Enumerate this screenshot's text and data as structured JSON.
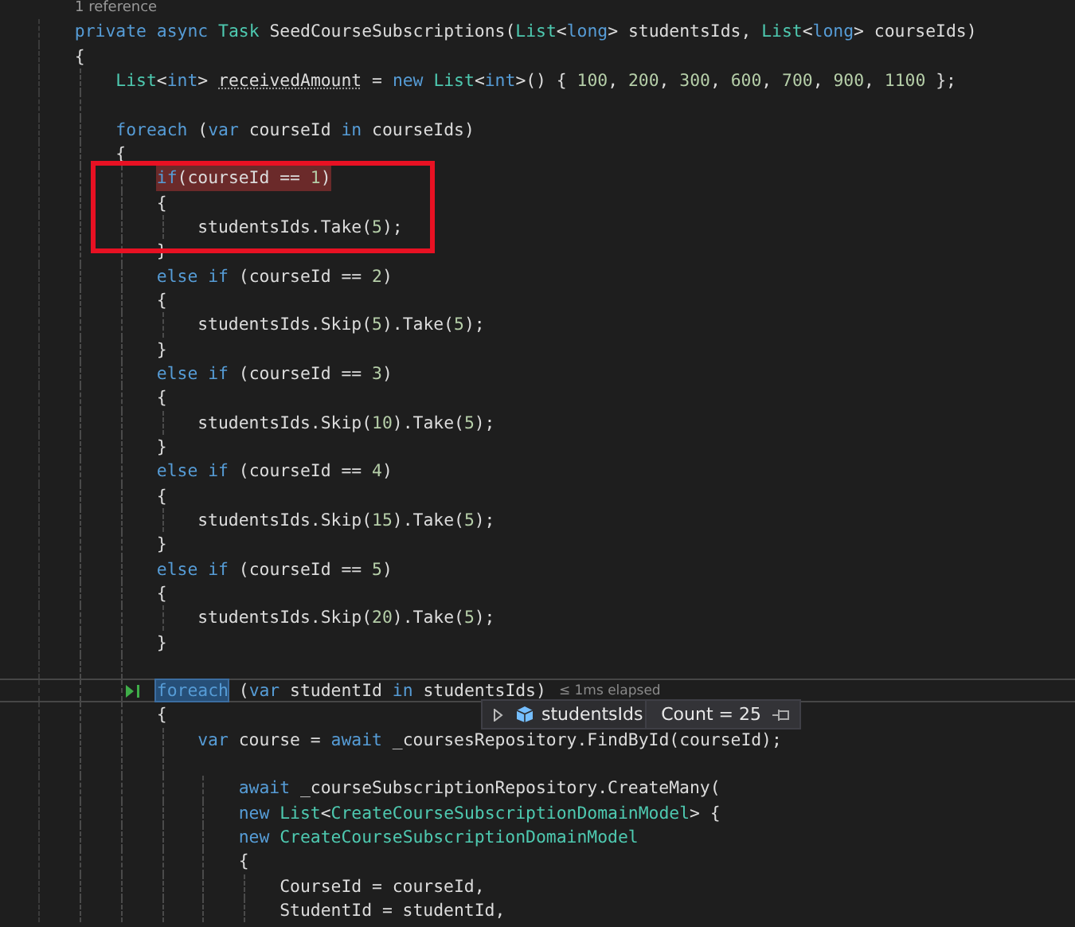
{
  "codelens": "1 reference",
  "lines": [
    {
      "kind": "code",
      "tokens": [
        {
          "kind": "kw",
          "text": "private "
        },
        {
          "kind": "kw",
          "text": "async "
        },
        {
          "kind": "ty",
          "text": "Task"
        },
        {
          "kind": "txt",
          "text": " SeedCourseSubscriptions("
        },
        {
          "kind": "ty",
          "text": "List"
        },
        {
          "kind": "txt",
          "text": "<"
        },
        {
          "kind": "kw",
          "text": "long"
        },
        {
          "kind": "txt",
          "text": "> studentsIds, "
        },
        {
          "kind": "ty",
          "text": "List"
        },
        {
          "kind": "txt",
          "text": "<"
        },
        {
          "kind": "kw",
          "text": "long"
        },
        {
          "kind": "txt",
          "text": "> courseIds)"
        }
      ]
    },
    {
      "kind": "code",
      "tokens": [
        {
          "kind": "txt",
          "text": "{"
        }
      ],
      "children": [
        {
          "kind": "code",
          "tokens": [
            {
              "kind": "ty",
              "text": "List"
            },
            {
              "kind": "txt",
              "text": "<"
            },
            {
              "kind": "kw",
              "text": "int"
            },
            {
              "kind": "txt",
              "text": "> "
            },
            {
              "kind": "hint",
              "text": "receivedAmount"
            },
            {
              "kind": "txt",
              "text": " = "
            },
            {
              "kind": "kw",
              "text": "new "
            },
            {
              "kind": "ty",
              "text": "List"
            },
            {
              "kind": "txt",
              "text": "<"
            },
            {
              "kind": "kw",
              "text": "int"
            },
            {
              "kind": "txt",
              "text": ">() { "
            },
            {
              "kind": "num",
              "text": "100"
            },
            {
              "kind": "txt",
              "text": ", "
            },
            {
              "kind": "num",
              "text": "200"
            },
            {
              "kind": "txt",
              "text": ", "
            },
            {
              "kind": "num",
              "text": "300"
            },
            {
              "kind": "txt",
              "text": ", "
            },
            {
              "kind": "num",
              "text": "600"
            },
            {
              "kind": "txt",
              "text": ", "
            },
            {
              "kind": "num",
              "text": "700"
            },
            {
              "kind": "txt",
              "text": ", "
            },
            {
              "kind": "num",
              "text": "900"
            },
            {
              "kind": "txt",
              "text": ", "
            },
            {
              "kind": "num",
              "text": "1100"
            },
            {
              "kind": "txt",
              "text": " };"
            }
          ]
        },
        {
          "kind": "blank"
        },
        {
          "kind": "code",
          "tokens": [
            {
              "kind": "kw",
              "text": "foreach"
            },
            {
              "kind": "txt",
              "text": " ("
            },
            {
              "kind": "kw",
              "text": "var"
            },
            {
              "kind": "txt",
              "text": " courseId "
            },
            {
              "kind": "kw",
              "text": "in"
            },
            {
              "kind": "txt",
              "text": " courseIds)"
            }
          ]
        },
        {
          "kind": "code",
          "tokens": [
            {
              "kind": "txt",
              "text": "{"
            }
          ],
          "children": [
            {
              "kind": "hit",
              "tokens": [
                {
                  "kind": "kw",
                  "text": "if"
                },
                {
                  "kind": "txt",
                  "text": "(courseId == "
                },
                {
                  "kind": "num",
                  "text": "1"
                },
                {
                  "kind": "txt",
                  "text": ")"
                }
              ]
            },
            {
              "kind": "code",
              "tokens": [
                {
                  "kind": "txt",
                  "text": "{"
                }
              ],
              "children": [
                {
                  "kind": "code",
                  "tokens": [
                    {
                      "kind": "txt",
                      "text": "studentsIds.Take("
                    },
                    {
                      "kind": "num",
                      "text": "5"
                    },
                    {
                      "kind": "txt",
                      "text": ");"
                    }
                  ]
                }
              ]
            },
            {
              "kind": "code",
              "tokens": [
                {
                  "kind": "txt",
                  "text": "}"
                }
              ]
            },
            {
              "kind": "code",
              "tokens": [
                {
                  "kind": "kw",
                  "text": "else "
                },
                {
                  "kind": "kw",
                  "text": "if"
                },
                {
                  "kind": "txt",
                  "text": " (courseId == "
                },
                {
                  "kind": "num",
                  "text": "2"
                },
                {
                  "kind": "txt",
                  "text": ")"
                }
              ]
            },
            {
              "kind": "code",
              "tokens": [
                {
                  "kind": "txt",
                  "text": "{"
                }
              ],
              "children": [
                {
                  "kind": "code",
                  "tokens": [
                    {
                      "kind": "txt",
                      "text": "studentsIds.Skip("
                    },
                    {
                      "kind": "num",
                      "text": "5"
                    },
                    {
                      "kind": "txt",
                      "text": ").Take("
                    },
                    {
                      "kind": "num",
                      "text": "5"
                    },
                    {
                      "kind": "txt",
                      "text": ");"
                    }
                  ]
                }
              ]
            },
            {
              "kind": "code",
              "tokens": [
                {
                  "kind": "txt",
                  "text": "}"
                }
              ]
            },
            {
              "kind": "code",
              "tokens": [
                {
                  "kind": "kw",
                  "text": "else "
                },
                {
                  "kind": "kw",
                  "text": "if"
                },
                {
                  "kind": "txt",
                  "text": " (courseId == "
                },
                {
                  "kind": "num",
                  "text": "3"
                },
                {
                  "kind": "txt",
                  "text": ")"
                }
              ]
            },
            {
              "kind": "code",
              "tokens": [
                {
                  "kind": "txt",
                  "text": "{"
                }
              ],
              "children": [
                {
                  "kind": "code",
                  "tokens": [
                    {
                      "kind": "txt",
                      "text": "studentsIds.Skip("
                    },
                    {
                      "kind": "num",
                      "text": "10"
                    },
                    {
                      "kind": "txt",
                      "text": ").Take("
                    },
                    {
                      "kind": "num",
                      "text": "5"
                    },
                    {
                      "kind": "txt",
                      "text": ");"
                    }
                  ]
                }
              ]
            },
            {
              "kind": "code",
              "tokens": [
                {
                  "kind": "txt",
                  "text": "}"
                }
              ]
            },
            {
              "kind": "code",
              "tokens": [
                {
                  "kind": "kw",
                  "text": "else "
                },
                {
                  "kind": "kw",
                  "text": "if"
                },
                {
                  "kind": "txt",
                  "text": " (courseId == "
                },
                {
                  "kind": "num",
                  "text": "4"
                },
                {
                  "kind": "txt",
                  "text": ")"
                }
              ]
            },
            {
              "kind": "code",
              "tokens": [
                {
                  "kind": "txt",
                  "text": "{"
                }
              ],
              "children": [
                {
                  "kind": "code",
                  "tokens": [
                    {
                      "kind": "txt",
                      "text": "studentsIds.Skip("
                    },
                    {
                      "kind": "num",
                      "text": "15"
                    },
                    {
                      "kind": "txt",
                      "text": ").Take("
                    },
                    {
                      "kind": "num",
                      "text": "5"
                    },
                    {
                      "kind": "txt",
                      "text": ");"
                    }
                  ]
                }
              ]
            },
            {
              "kind": "code",
              "tokens": [
                {
                  "kind": "txt",
                  "text": "}"
                }
              ]
            },
            {
              "kind": "code",
              "tokens": [
                {
                  "kind": "kw",
                  "text": "else "
                },
                {
                  "kind": "kw",
                  "text": "if"
                },
                {
                  "kind": "txt",
                  "text": " (courseId == "
                },
                {
                  "kind": "num",
                  "text": "5"
                },
                {
                  "kind": "txt",
                  "text": ")"
                }
              ]
            },
            {
              "kind": "code",
              "tokens": [
                {
                  "kind": "txt",
                  "text": "{"
                }
              ],
              "children": [
                {
                  "kind": "code",
                  "tokens": [
                    {
                      "kind": "txt",
                      "text": "studentsIds.Skip("
                    },
                    {
                      "kind": "num",
                      "text": "20"
                    },
                    {
                      "kind": "txt",
                      "text": ").Take("
                    },
                    {
                      "kind": "num",
                      "text": "5"
                    },
                    {
                      "kind": "txt",
                      "text": ");"
                    }
                  ]
                }
              ]
            },
            {
              "kind": "code",
              "tokens": [
                {
                  "kind": "txt",
                  "text": "}"
                }
              ]
            },
            {
              "kind": "blank"
            },
            {
              "kind": "current",
              "elapsed": "≤ 1ms elapsed",
              "tokens": [
                {
                  "kind": "sel",
                  "text": "foreach"
                },
                {
                  "kind": "txt",
                  "text": " ("
                },
                {
                  "kind": "kw",
                  "text": "var"
                },
                {
                  "kind": "txt",
                  "text": " studentId "
                },
                {
                  "kind": "kw",
                  "text": "in"
                },
                {
                  "kind": "txt",
                  "text": " studentsIds)"
                }
              ]
            },
            {
              "kind": "code",
              "tokens": [
                {
                  "kind": "txt",
                  "text": "{"
                }
              ],
              "children": [
                {
                  "kind": "code",
                  "tokens": [
                    {
                      "kind": "kw",
                      "text": "var"
                    },
                    {
                      "kind": "txt",
                      "text": " course = "
                    },
                    {
                      "kind": "kw",
                      "text": "await"
                    },
                    {
                      "kind": "txt",
                      "text": " _coursesRepository.FindById(courseId);"
                    }
                  ]
                },
                {
                  "kind": "blank",
                  "children": [
                    {
                      "kind": "code",
                      "tokens": [
                        {
                          "kind": "kw",
                          "text": "await"
                        },
                        {
                          "kind": "txt",
                          "text": " _courseSubscriptionRepository.CreateMany("
                        }
                      ]
                    },
                    {
                      "kind": "code",
                      "tokens": [
                        {
                          "kind": "kw",
                          "text": "new "
                        },
                        {
                          "kind": "ty",
                          "text": "List"
                        },
                        {
                          "kind": "txt",
                          "text": "<"
                        },
                        {
                          "kind": "ty",
                          "text": "CreateCourseSubscriptionDomainModel"
                        },
                        {
                          "kind": "txt",
                          "text": "> {"
                        }
                      ]
                    },
                    {
                      "kind": "code",
                      "tokens": [
                        {
                          "kind": "kw",
                          "text": "new "
                        },
                        {
                          "kind": "ty",
                          "text": "CreateCourseSubscriptionDomainModel"
                        }
                      ]
                    },
                    {
                      "kind": "code",
                      "tokens": [
                        {
                          "kind": "txt",
                          "text": "{"
                        }
                      ],
                      "children": [
                        {
                          "kind": "code",
                          "tokens": [
                            {
                              "kind": "txt",
                              "text": "CourseId = courseId,"
                            }
                          ]
                        },
                        {
                          "kind": "code",
                          "tokens": [
                            {
                              "kind": "txt",
                              "text": "StudentId = studentId,"
                            }
                          ]
                        }
                      ]
                    }
                  ]
                }
              ]
            }
          ]
        }
      ]
    }
  ],
  "datatip": {
    "name": "studentsIds",
    "value": "Count = 25"
  }
}
